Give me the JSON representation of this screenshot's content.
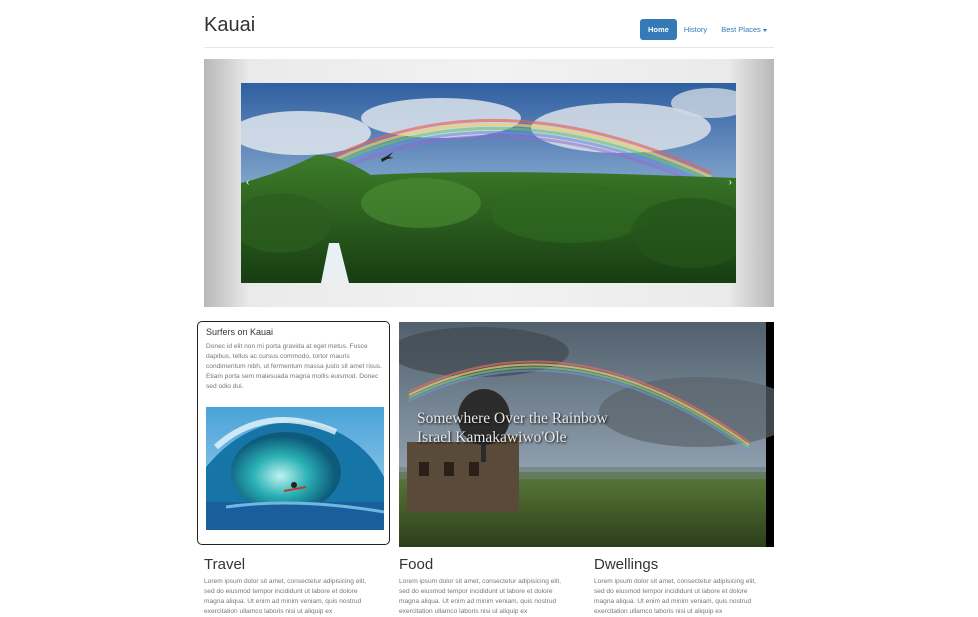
{
  "header": {
    "brand": "Kauai",
    "nav": [
      {
        "label": "Home",
        "active": true
      },
      {
        "label": "History",
        "active": false
      },
      {
        "label": "Best Places",
        "active": false,
        "dropdown": true
      }
    ]
  },
  "carousel": {
    "prev_icon": "chevron-left-icon",
    "next_icon": "chevron-right-icon",
    "prev_glyph": "‹",
    "next_glyph": "›"
  },
  "feature": {
    "title": "Surfers on Kauai",
    "text": "Donec id elit non mi porta gravida at eget metus. Fusce dapibus, tellus ac cursus commodo, tortor mauris condimentum nibh, ut fermentum massa justo sit amet risus. Etiam porta sem malesuada magna mollis euismod. Donec sed odio dui."
  },
  "video": {
    "caption_line1": "Somewhere Over the Rainbow",
    "caption_line2": "Israel Kamakawiwo'Ole"
  },
  "columns": [
    {
      "title": "Travel",
      "text": "Lorem ipsum dolor sit amet, consectetur adipisicing elit, sed do eiusmod tempor incididunt ut labore et dolore magna aliqua. Ut enim ad minim veniam, quis nostrud exercitation ullamco laboris nisi ut aliquip ex"
    },
    {
      "title": "Food",
      "text": "Lorem ipsum dolor sit amet, consectetur adipisicing elit, sed do eiusmod tempor incididunt ut labore et dolore magna aliqua. Ut enim ad minim veniam, quis nostrud exercitation ullamco laboris nisi ut aliquip ex"
    },
    {
      "title": "Dwellings",
      "text": "Lorem ipsum dolor sit amet, consectetur adipisicing elit, sed do eiusmod tempor incididunt ut labore et dolore magna aliqua. Ut enim ad minim veniam, quis nostrud exercitation ullamco laboris nisi ut aliquip ex"
    }
  ],
  "colors": {
    "accent": "#337ab7"
  }
}
